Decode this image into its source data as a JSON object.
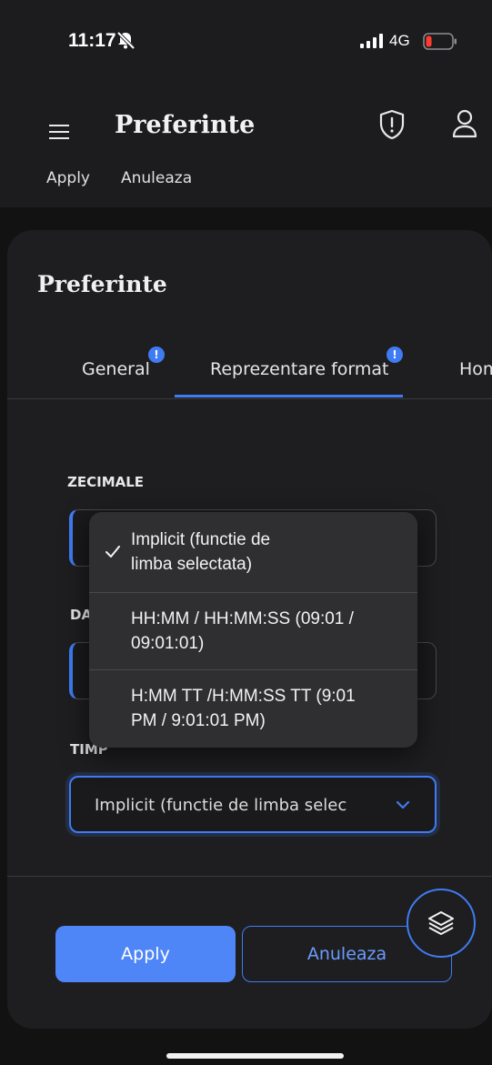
{
  "status_bar": {
    "time": "11:17",
    "network": "4G"
  },
  "header": {
    "title": "Preferinte",
    "clipped_apply": "Apply",
    "clipped_cancel": "Anuleaza"
  },
  "sheet": {
    "title": "Preferinte",
    "tabs": [
      {
        "label": "General",
        "badge": "!"
      },
      {
        "label": "Reprezentare format",
        "badge": "!",
        "active": true
      },
      {
        "label": "Home"
      }
    ],
    "fields": {
      "zecimale": {
        "label": "ZECIMALE"
      },
      "data": {
        "label": "DA"
      },
      "timp": {
        "label": "TIMP",
        "value": "Implicit (functie de limba selec"
      }
    },
    "dropdown_options": [
      {
        "label": "Implicit (functie de limba selectata)",
        "line1": "Implicit (functie de",
        "line2": "limba selectata)",
        "selected": true
      },
      {
        "label": "HH:MM / HH:MM:SS (09:01 / 09:01:01)",
        "line1": "HH:MM / HH:MM:SS (09:01 /",
        "line2": "09:01:01)"
      },
      {
        "label": "H:MM TT /H:MM:SS TT (9:01 PM / 9:01:01 PM)",
        "line1": "H:MM TT /H:MM:SS TT (9:01",
        "line2": "PM / 9:01:01 PM)"
      }
    ],
    "apply_label": "Apply",
    "cancel_label": "Anuleaza"
  },
  "colors": {
    "accent": "#3f7bf2",
    "apply_bg": "#4f86f7",
    "sheet_bg": "#1e1e20",
    "dropdown_bg": "#2f2f32"
  }
}
